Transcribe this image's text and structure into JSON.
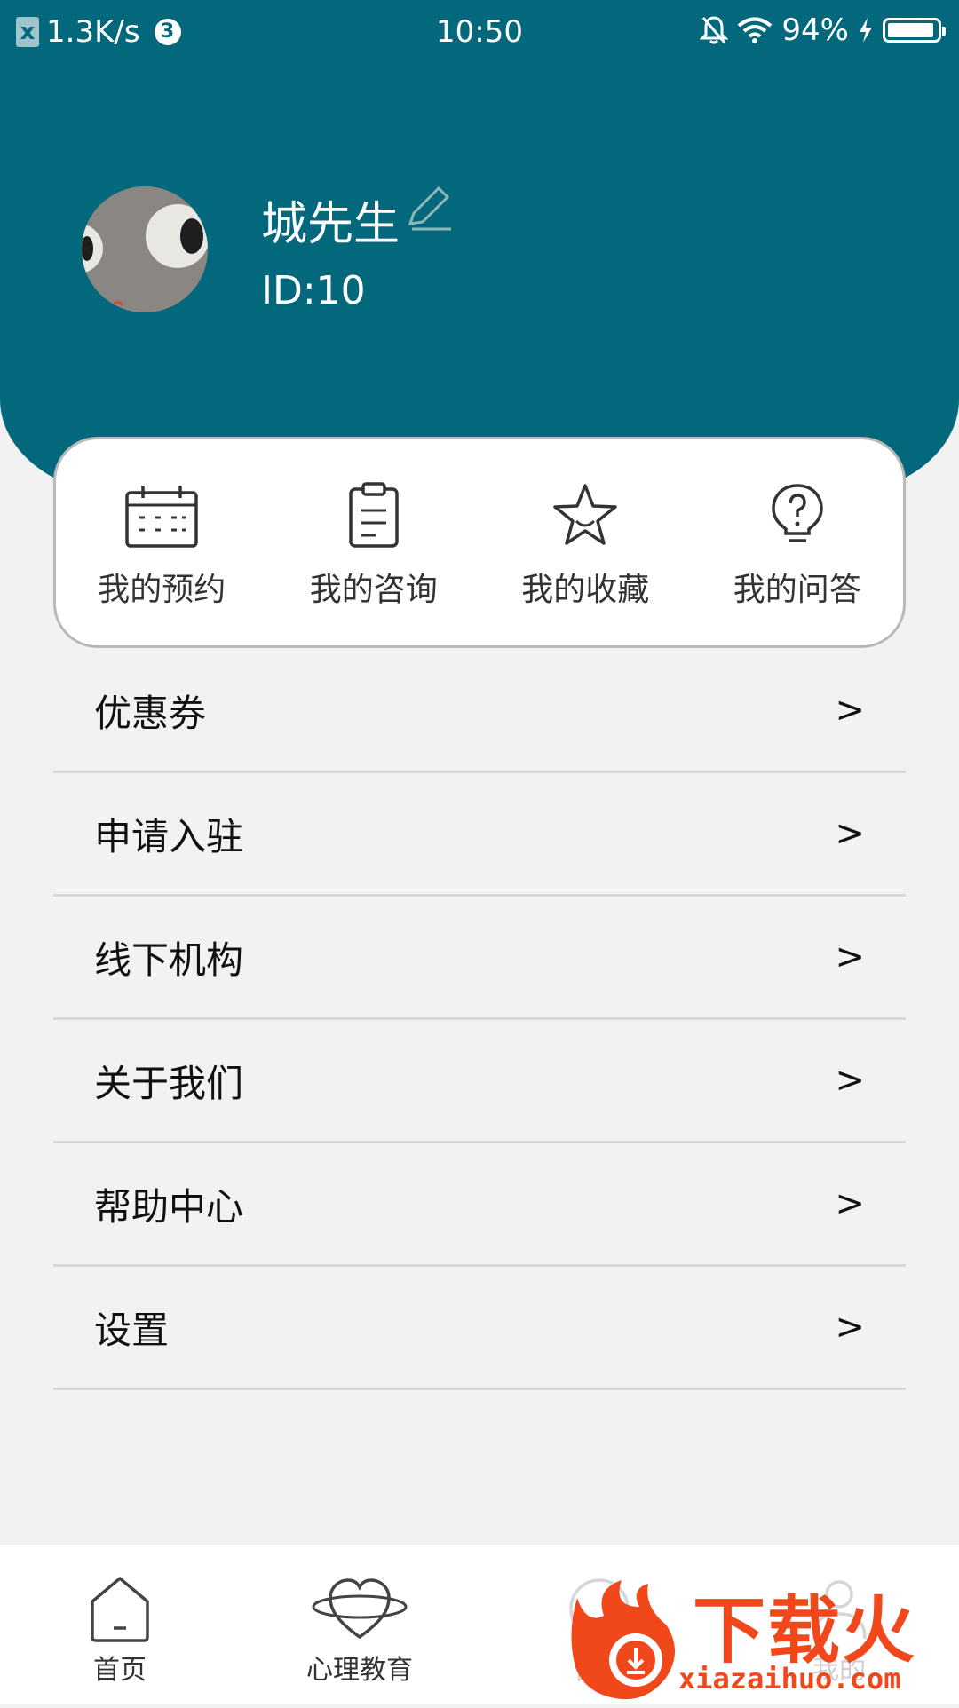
{
  "status_bar": {
    "left_icon": "x-badge",
    "net_speed": "1.3K/s",
    "notification_count": "3",
    "time": "10:50",
    "battery_percent": "94%",
    "battery_level": 0.94,
    "icons": [
      "bell-off-icon",
      "wifi-icon",
      "charging-icon",
      "battery-icon"
    ]
  },
  "colors": {
    "header": "#03687b",
    "background": "#f2f2f2",
    "watermark": "#f0471b"
  },
  "profile": {
    "name": "城先生",
    "id_text": "ID:10",
    "avatar": "avatar-image",
    "edit_icon": "pencil-icon"
  },
  "quick_actions": [
    {
      "label": "我的预约",
      "icon": "calendar-icon"
    },
    {
      "label": "我的咨询",
      "icon": "clipboard-icon"
    },
    {
      "label": "我的收藏",
      "icon": "star-icon"
    },
    {
      "label": "我的问答",
      "icon": "question-bulb-icon"
    }
  ],
  "menu": [
    {
      "label": "优惠券",
      "arrow": ">"
    },
    {
      "label": "申请入驻",
      "arrow": ">"
    },
    {
      "label": "线下机构",
      "arrow": ">"
    },
    {
      "label": "关于我们",
      "arrow": ">"
    },
    {
      "label": "帮助中心",
      "arrow": ">"
    },
    {
      "label": "设置",
      "arrow": ">"
    }
  ],
  "tabbar": [
    {
      "label": "首页",
      "icon": "home-icon"
    },
    {
      "label": "心理教育",
      "icon": "heart-planet-icon"
    },
    {
      "label": "咨询",
      "icon": "chat-icon"
    },
    {
      "label": "我的",
      "icon": "profile-icon"
    }
  ],
  "watermark": {
    "text": "下载火",
    "url": "xiazaihuo.com"
  }
}
